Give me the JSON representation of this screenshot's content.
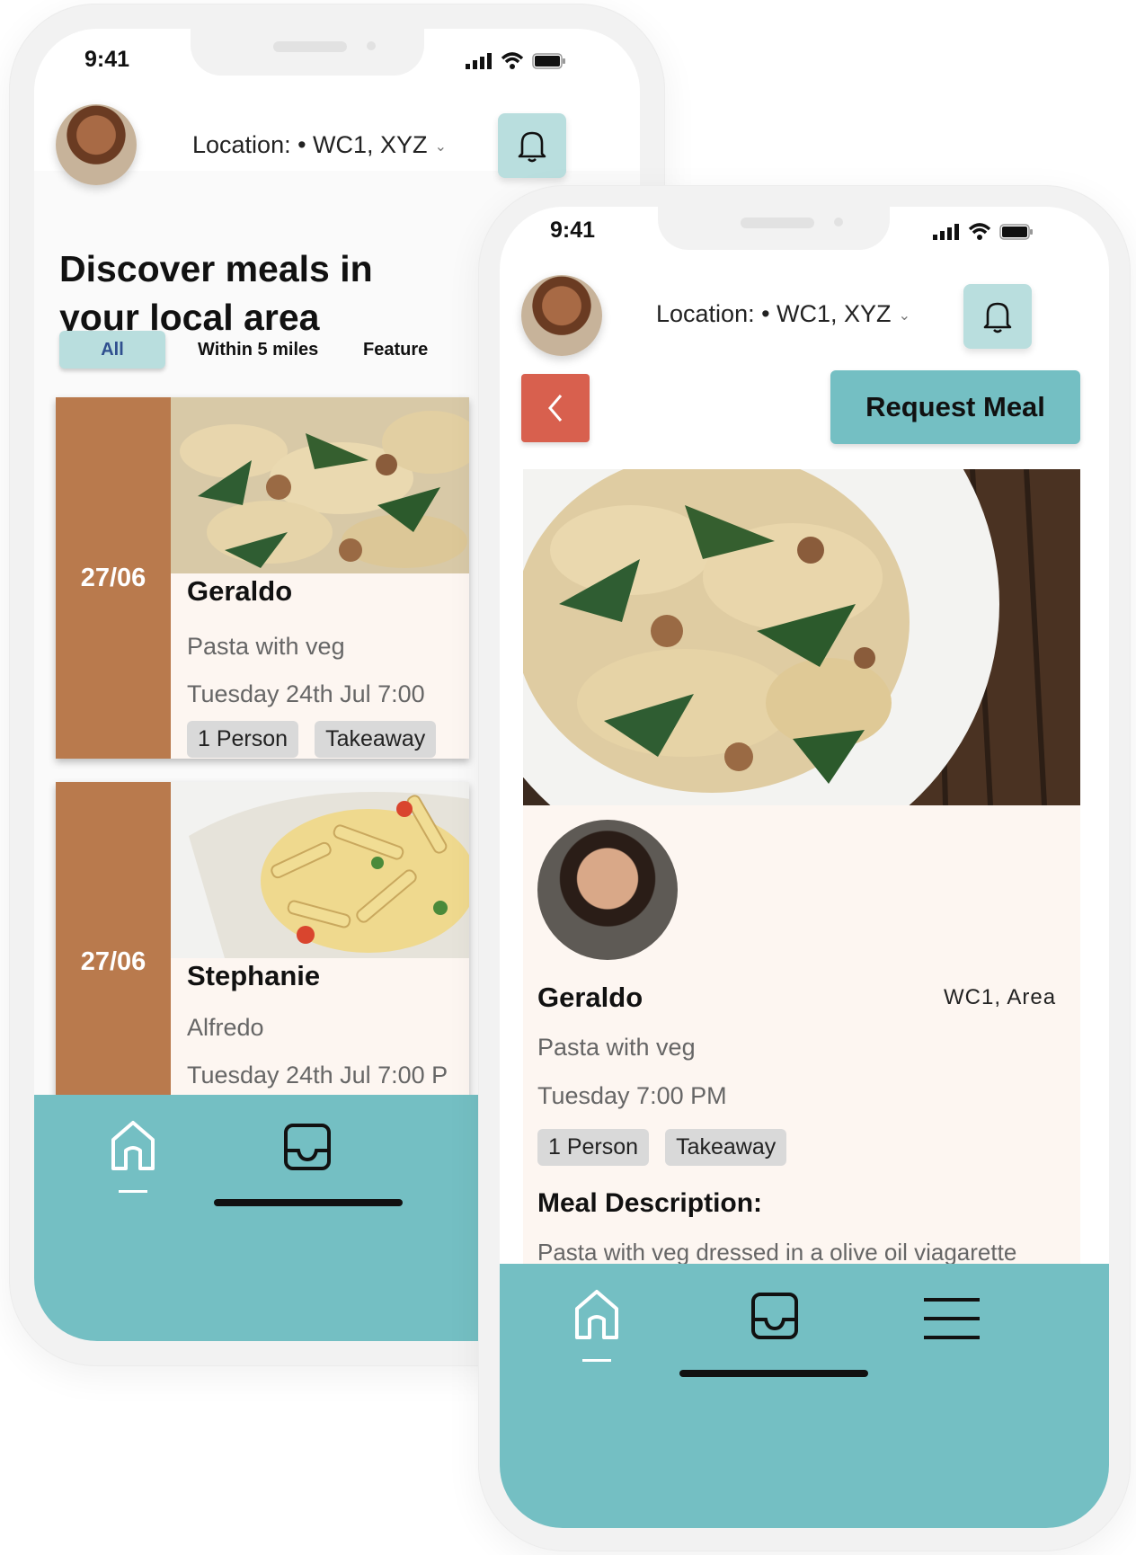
{
  "left_phone": {
    "status": {
      "time": "9:41"
    },
    "header": {
      "location": "Location: • WC1, XYZ"
    },
    "headline": "Discover meals in your local area",
    "filters": [
      "All",
      "Within 5 miles",
      "Feature"
    ],
    "meals": [
      {
        "date": "27/06",
        "cook": "Geraldo",
        "dish": "Pasta with veg",
        "when": "Tuesday 24th Jul  7:00",
        "tags": [
          "1 Person",
          "Takeaway"
        ]
      },
      {
        "date": "27/06",
        "cook": "Stephanie",
        "dish": "Alfredo",
        "when": "Tuesday 24th Jul  7:00 P",
        "tags": []
      }
    ]
  },
  "right_phone": {
    "status": {
      "time": "9:41"
    },
    "header": {
      "location": "Location: • WC1, XYZ"
    },
    "request_button": "Request Meal",
    "detail": {
      "cook": "Geraldo",
      "area": "WC1, Area",
      "dish": "Pasta with veg",
      "time": "Tuesday 7:00 PM",
      "tags": [
        "1 Person",
        "Takeaway"
      ],
      "description_title": "Meal Description:",
      "description": "Pasta with veg dressed in a olive oil viagarette topped with herbs"
    }
  },
  "colors": {
    "accent_teal": "#74bfc3",
    "light_teal": "#b9dede",
    "date_strip": "#b97a4d",
    "back_button": "#d8604e",
    "card_background": "#fdf6f1"
  },
  "icons": [
    "signal-icon",
    "wifi-icon",
    "battery-icon",
    "bell-icon",
    "chevron-down-icon",
    "chevron-left-icon",
    "home-icon",
    "inbox-icon",
    "menu-icon"
  ]
}
